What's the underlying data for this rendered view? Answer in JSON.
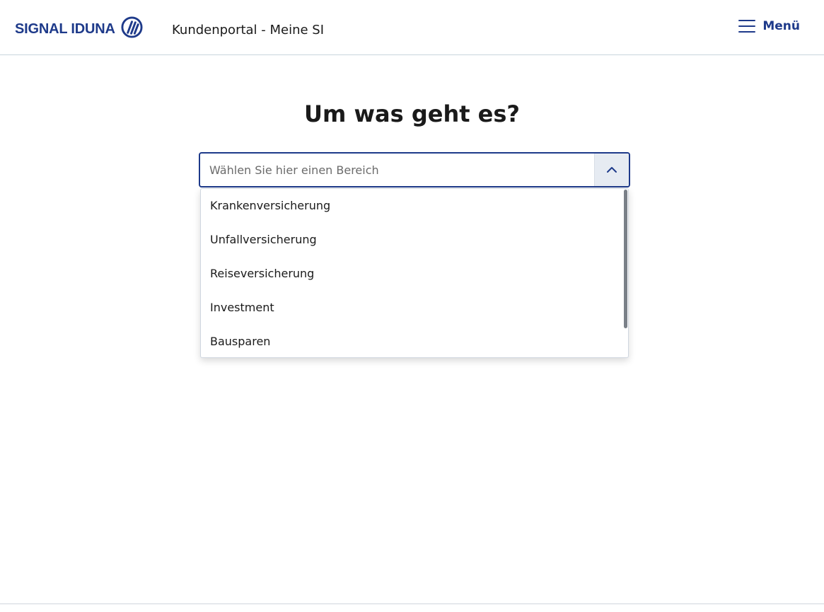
{
  "header": {
    "logo_text": "SIGNAL IDUNA",
    "portal_title": "Kundenportal - Meine SI",
    "menu_label": "Menü",
    "menu_icon": "hamburger-icon",
    "logo_icon": "signal-iduna-logo-mark"
  },
  "main": {
    "heading": "Um was geht es?",
    "select": {
      "placeholder": "Wählen Sie hier einen Bereich",
      "toggle_icon": "chevron-up-icon",
      "options": [
        "Krankenversicherung",
        "Unfallversicherung",
        "Reiseversicherung",
        "Investment",
        "Bausparen"
      ]
    }
  },
  "colors": {
    "brand": "#1e3a8a",
    "toggle_bg": "#e6ebf2"
  }
}
